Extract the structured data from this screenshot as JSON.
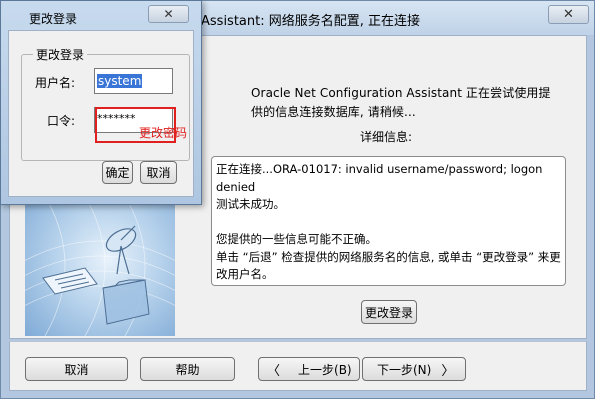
{
  "main_window": {
    "title": "Assistant: 网络服务名配置, 正在连接",
    "close_glyph": "✕",
    "message": "Oracle Net Configuration Assistant 正在尝试使用提供的信息连接数据库, 请稍候...",
    "detail_label": "详细信息:",
    "detail_lines": [
      "正在连接...ORA-01017: invalid username/password; logon denied",
      "测试未成功。",
      "",
      "您提供的一些信息可能不正确。",
      "单击 “后退” 检查提供的网络服务名的信息, 或单击 “更改登录” 来更改用户名。"
    ],
    "change_login_button": "更改登录",
    "footer": {
      "cancel": "取消",
      "help": "帮助",
      "back": "上一步(B)",
      "next": "下一步(N)"
    }
  },
  "dialog": {
    "title": "更改登录",
    "close_glyph": "✕",
    "group_title": "更改登录",
    "username_label": "用户名:",
    "username_value": "system",
    "password_label": "口令:",
    "password_value": "*******",
    "ok": "确定",
    "cancel": "取消"
  },
  "annotation": {
    "text": "更改密码",
    "color": "#e0201e"
  }
}
